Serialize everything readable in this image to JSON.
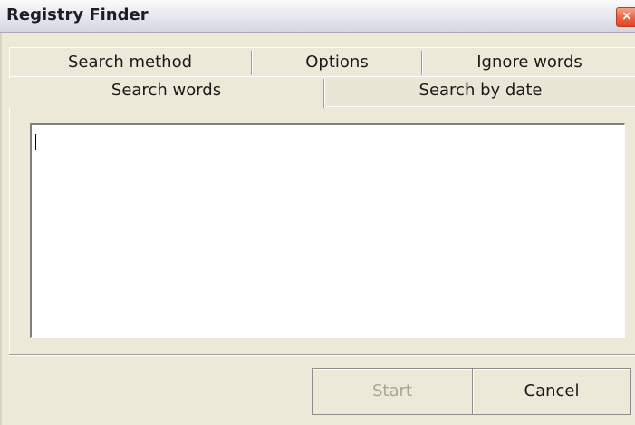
{
  "window": {
    "title": "Registry Finder",
    "close_glyph": "×"
  },
  "tabs": {
    "row1": [
      {
        "label": "Search method"
      },
      {
        "label": "Options"
      },
      {
        "label": "Ignore words"
      }
    ],
    "row2": [
      {
        "label": "Search words",
        "selected": true
      },
      {
        "label": "Search by date",
        "selected": false
      }
    ]
  },
  "search_words": {
    "value": ""
  },
  "buttons": {
    "start_label": "Start",
    "start_enabled": false,
    "cancel_label": "Cancel"
  },
  "colors": {
    "dialog_bg": "#ece9d8",
    "close_button": "#e8603f",
    "disabled_text": "#a7a597"
  }
}
